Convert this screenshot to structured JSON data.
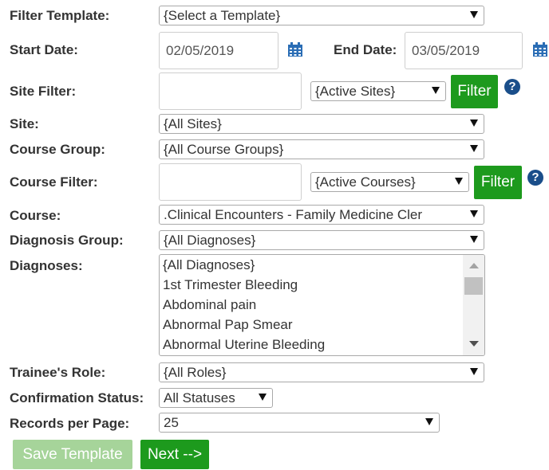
{
  "labels": {
    "filter_template": "Filter Template:",
    "start_date": "Start Date:",
    "end_date": "End Date:",
    "site_filter": "Site Filter:",
    "site": "Site:",
    "course_group": "Course Group:",
    "course_filter": "Course Filter:",
    "course": "Course:",
    "diagnosis_group": "Diagnosis Group:",
    "diagnoses": "Diagnoses:",
    "trainee_role": "Trainee's Role:",
    "confirmation_status": "Confirmation Status:",
    "records_per_page": "Records per Page:"
  },
  "selects": {
    "filter_template": "{Select a Template}",
    "site_filter_scope": "{Active Sites}",
    "site": "{All Sites}",
    "course_group": "{All Course Groups}",
    "course_filter_scope": "{Active Courses}",
    "course": ".Clinical Encounters - Family Medicine Cler",
    "diagnosis_group": "{All Diagnoses}",
    "trainee_role": "{All Roles}",
    "confirmation_status": "All Statuses",
    "records_per_page": "25"
  },
  "inputs": {
    "start_date": "02/05/2019",
    "end_date": "03/05/2019",
    "site_filter": "",
    "course_filter": ""
  },
  "diagnoses_options": [
    "{All Diagnoses}",
    "1st Trimester Bleeding",
    "Abdominal pain",
    "Abnormal Pap Smear",
    "Abnormal Uterine Bleeding"
  ],
  "buttons": {
    "filter": "Filter",
    "help": "?",
    "save_template": "Save Template",
    "next": "Next -->"
  },
  "colors": {
    "button_green": "#1d9a1d",
    "button_disabled": "#a6d49a",
    "help_blue": "#1a4e8a",
    "calendar_blue": "#2a6db5"
  },
  "icons": {
    "calendar": "calendar-icon",
    "help": "question-circle-icon",
    "dropdown": "chevron-down-icon"
  }
}
